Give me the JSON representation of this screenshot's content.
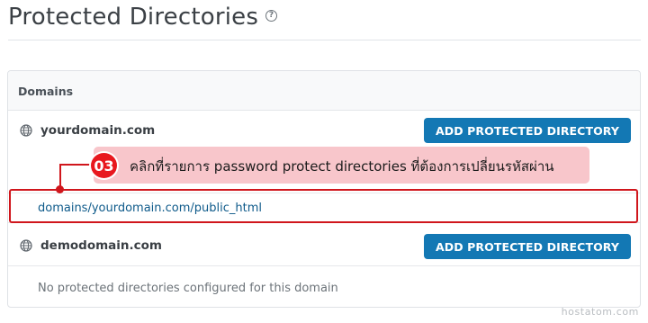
{
  "page": {
    "title": "Protected Directories",
    "help_glyph": "?"
  },
  "card": {
    "header": "Domains"
  },
  "domains": [
    {
      "name": "yourdomain.com",
      "button_label": "ADD PROTECTED DIRECTORY",
      "directories": [
        "domains/yourdomain.com/public_html"
      ]
    },
    {
      "name": "demodomain.com",
      "button_label": "ADD PROTECTED DIRECTORY",
      "empty_message": "No protected directories configured for this domain"
    }
  ],
  "annotation": {
    "step": "03",
    "text": "คลิกที่รายการ password protect directories ที่ต้องการเปลี่ยนรหัสผ่าน"
  },
  "watermark": "hostatom.com",
  "colors": {
    "button": "#1378b4",
    "link": "#0e5a8a",
    "annotation_red": "#d0161c",
    "callout_bg": "#f8c6cb"
  },
  "icons": {
    "domain": "globe-icon",
    "help": "help-circle-icon"
  }
}
